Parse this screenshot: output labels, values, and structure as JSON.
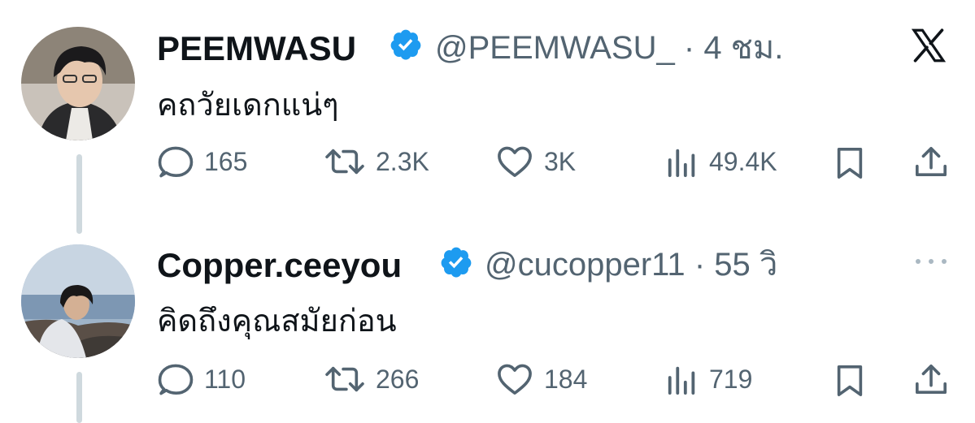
{
  "tweets": [
    {
      "display_name": "PEEMWASU",
      "handle": "@PEEMWASU_",
      "separator": "·",
      "time": "4 ชม.",
      "text": "คถวัยเดกแน่ๆ",
      "replies": "165",
      "reposts": "2.3K",
      "likes": "3K",
      "views": "49.4K"
    },
    {
      "display_name": "Copper.ceeyou",
      "handle": "@cucopper11",
      "separator": "·",
      "time": "55 วิ",
      "text": "คิดถึงคุณสมัยก่อน",
      "replies": "110",
      "reposts": "266",
      "likes": "184",
      "views": "719"
    }
  ],
  "colors": {
    "verified_badge": "#1d9bf0",
    "text_primary": "#0f1419",
    "text_secondary": "#536471",
    "thread_line": "#cfd9de"
  },
  "icons": [
    "x-logo-icon",
    "verified-badge-icon",
    "reply-icon",
    "repost-icon",
    "like-icon",
    "views-icon",
    "bookmark-icon",
    "share-icon",
    "more-icon"
  ]
}
